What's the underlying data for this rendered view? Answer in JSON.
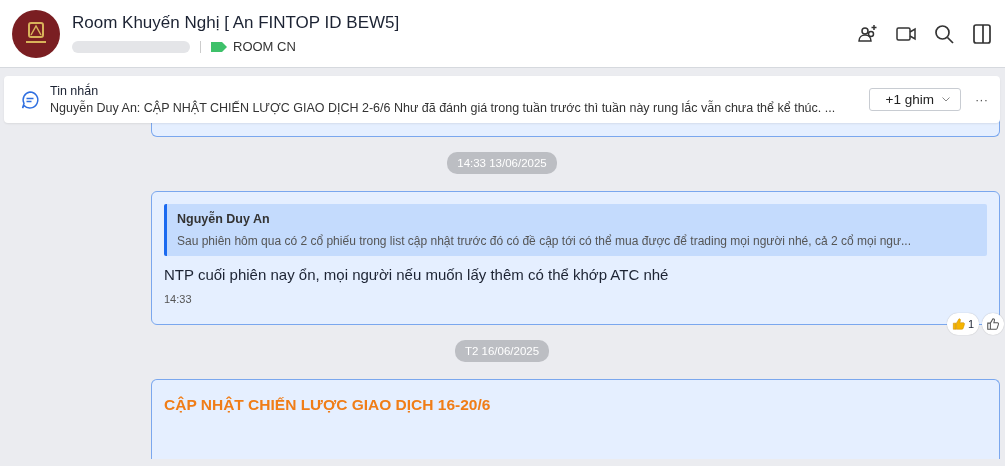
{
  "header": {
    "title": "Room Khuyến Nghị [ An FINTOP ID BEW5]",
    "tag": {
      "label": "ROOM CN",
      "color": "#3ec16a"
    }
  },
  "pinned": {
    "title": "Tin nhắn",
    "preview": "Nguyễn Duy An: CẬP NHẬT CHIẾN LƯỢC GIAO DỊCH 2-6/6 Như đã đánh giá trong tuần trước thì tuần này rung lắc vẫn chưa thể kể thúc. ...",
    "pin_button": "+1 ghim",
    "more": "···"
  },
  "messages": [
    {
      "kind": "partial"
    },
    {
      "kind": "date",
      "label": "14:33 13/06/2025"
    },
    {
      "kind": "reply",
      "quote_author": "Nguyễn Duy An",
      "quote_text": "Sau phiên hôm qua có 2 cổ phiếu trong list cập nhật trước đó có đề cập tới có thể mua được để trading mọi người nhé, cả 2 cổ mọi ngư...",
      "text": "NTP cuối phiên nay ổn, mọi người nếu muốn lấy thêm có thể khớp ATC nhé",
      "time": "14:33",
      "reaction_count": "1"
    },
    {
      "kind": "date",
      "label": "T2 16/06/2025"
    },
    {
      "kind": "heading",
      "title": "CẬP NHẬT CHIẾN LƯỢC GIAO DỊCH 16-20/6"
    }
  ]
}
